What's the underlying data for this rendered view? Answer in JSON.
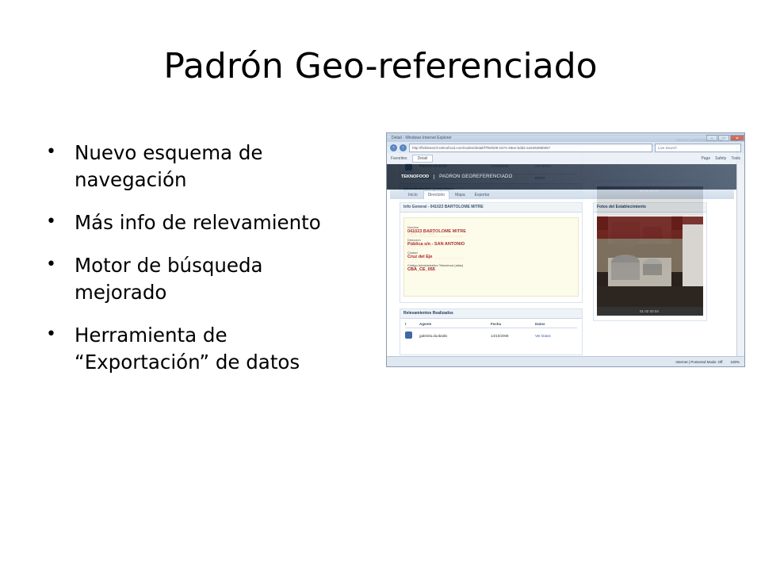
{
  "slide": {
    "title": "Padrón Geo-referenciado",
    "bullets": [
      "Nuevo esquema de navegación",
      "Más info de relevamiento",
      "Motor de búsqueda mejorado",
      "Herramienta de “Exportación” de datos"
    ]
  },
  "browser": {
    "window_title": "Detail - Windows Internet Explorer",
    "url": "http://fieldsearch.teknofood.com/nodes/detail/f7f84b09-1674-49ee-bdd2-a4426286b067",
    "search_placeholder": "Live Search",
    "favorites_label": "Favorites",
    "tab_label": "Detail",
    "toolbar": [
      "Page",
      "Safety",
      "Tools"
    ],
    "status_text": "Internet | Protected Mode: Off",
    "zoom": "100%"
  },
  "app": {
    "logo": "TEKNOFOOD",
    "title": "PADRON GEOREFERENCIADO",
    "tabs": [
      "Inicio",
      "Directorio",
      "Mapa",
      "Exportar"
    ],
    "info_header": "Info General - 041023 BARTOLOME MITRE",
    "fields": [
      {
        "label": "Nombre",
        "value": "041023 BARTOLOME MITRE"
      },
      {
        "label": "Dirección",
        "value": "Pública s/n - SAN ANTONIO"
      },
      {
        "label": "Ciudad",
        "value": "Cruz del Eje"
      },
      {
        "label": "Código Administrativo Teknofood (alias)",
        "value": "CBA_CE_055"
      }
    ],
    "photos_header": "Fotos del Establecimiento",
    "photo_pager": [
      "01",
      "02",
      "03",
      "04"
    ],
    "relevamientos_header": "Relevamientos Realizados",
    "columns": [
      "t",
      "Agente",
      "Fecha",
      "Datos"
    ],
    "rows": [
      {
        "agent": "gabriela.duobaitis",
        "date": "14/10/2008",
        "link": "Ver Datos"
      }
    ]
  }
}
